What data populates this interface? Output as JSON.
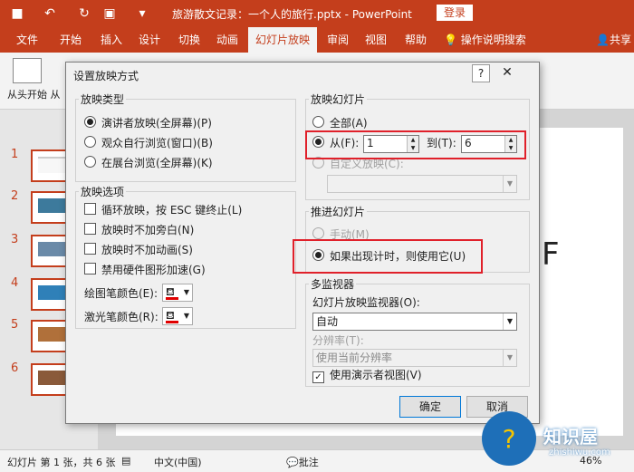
{
  "titlebar": {
    "title": "旅游散文记录：一个人的旅行.pptx - PowerPoint",
    "login": "登录",
    "quick_access": [
      "save-icon",
      "undo-icon",
      "redo-icon",
      "slideshow-icon",
      "dropdown-icon"
    ]
  },
  "tabs": [
    "文件",
    "开始",
    "插入",
    "设计",
    "切换",
    "动画",
    "幻灯片放映",
    "审阅",
    "视图",
    "帮助"
  ],
  "active_tab": "幻灯片放映",
  "tell_me": "操作说明搜索",
  "share": "共享",
  "ribbon": {
    "from_beginning": "从头开始 从"
  },
  "slides": [
    "1",
    "2",
    "3",
    "4",
    "5",
    "6"
  ],
  "slide_char": "F",
  "dialog": {
    "title": "设置放映方式",
    "help": "?",
    "show_type": {
      "title": "放映类型",
      "options": [
        "演讲者放映(全屏幕)(P)",
        "观众自行浏览(窗口)(B)",
        "在展台浏览(全屏幕)(K)"
      ],
      "selected_index": 0
    },
    "show_options": {
      "title": "放映选项",
      "checks": [
        "循环放映，按 ESC 键终止(L)",
        "放映时不加旁白(N)",
        "放映时不加动画(S)",
        "禁用硬件图形加速(G)"
      ],
      "pen_color_label": "绘图笔颜色(E):",
      "laser_color_label": "激光笔颜色(R):"
    },
    "show_slides": {
      "title": "放映幻灯片",
      "all": "全部(A)",
      "from": "从(F):",
      "from_value": "1",
      "to": "到(T):",
      "to_value": "6",
      "custom": "自定义放映(C):"
    },
    "advance": {
      "title": "推进幻灯片",
      "manual": "手动(M)",
      "timings": "如果出现计时，则使用它(U)"
    },
    "monitors": {
      "title": "多监视器",
      "monitor_label": "幻灯片放映监视器(O):",
      "monitor_value": "自动",
      "resolution_label": "分辨率(T):",
      "resolution_value": "使用当前分辨率",
      "presenter_view": "使用演示者视图(V)"
    },
    "ok": "确定",
    "cancel": "取消"
  },
  "status": {
    "slide_info": "幻灯片 第 1 张，共 6 张",
    "language": "中文(中国)",
    "comments": "批注",
    "zoom": "46%"
  },
  "watermark": {
    "brand": "知识屋",
    "url": "zhishiwu.com"
  },
  "colors": {
    "accent": "#c43e1c",
    "highlight": "#e0202a",
    "pen": "#e00000"
  }
}
